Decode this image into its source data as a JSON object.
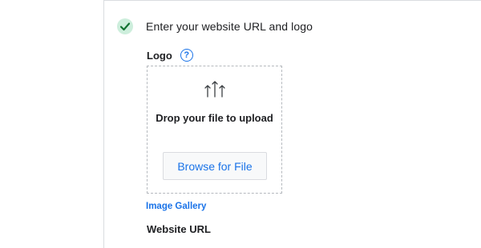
{
  "step": {
    "title": "Enter your website URL and logo",
    "status_icon": "check-icon",
    "status_color": "#cdeedc",
    "check_color": "#137333"
  },
  "logo": {
    "label": "Logo",
    "help_icon": "question-mark-icon",
    "help_glyph": "?",
    "dropzone": {
      "icon": "upload-arrows-icon",
      "text": "Drop your file to upload",
      "browse_label": "Browse for File"
    },
    "gallery_link": "Image Gallery"
  },
  "website": {
    "label": "Website URL"
  },
  "colors": {
    "accent": "#1a73e8",
    "border": "#dadce0",
    "text": "#202124"
  }
}
